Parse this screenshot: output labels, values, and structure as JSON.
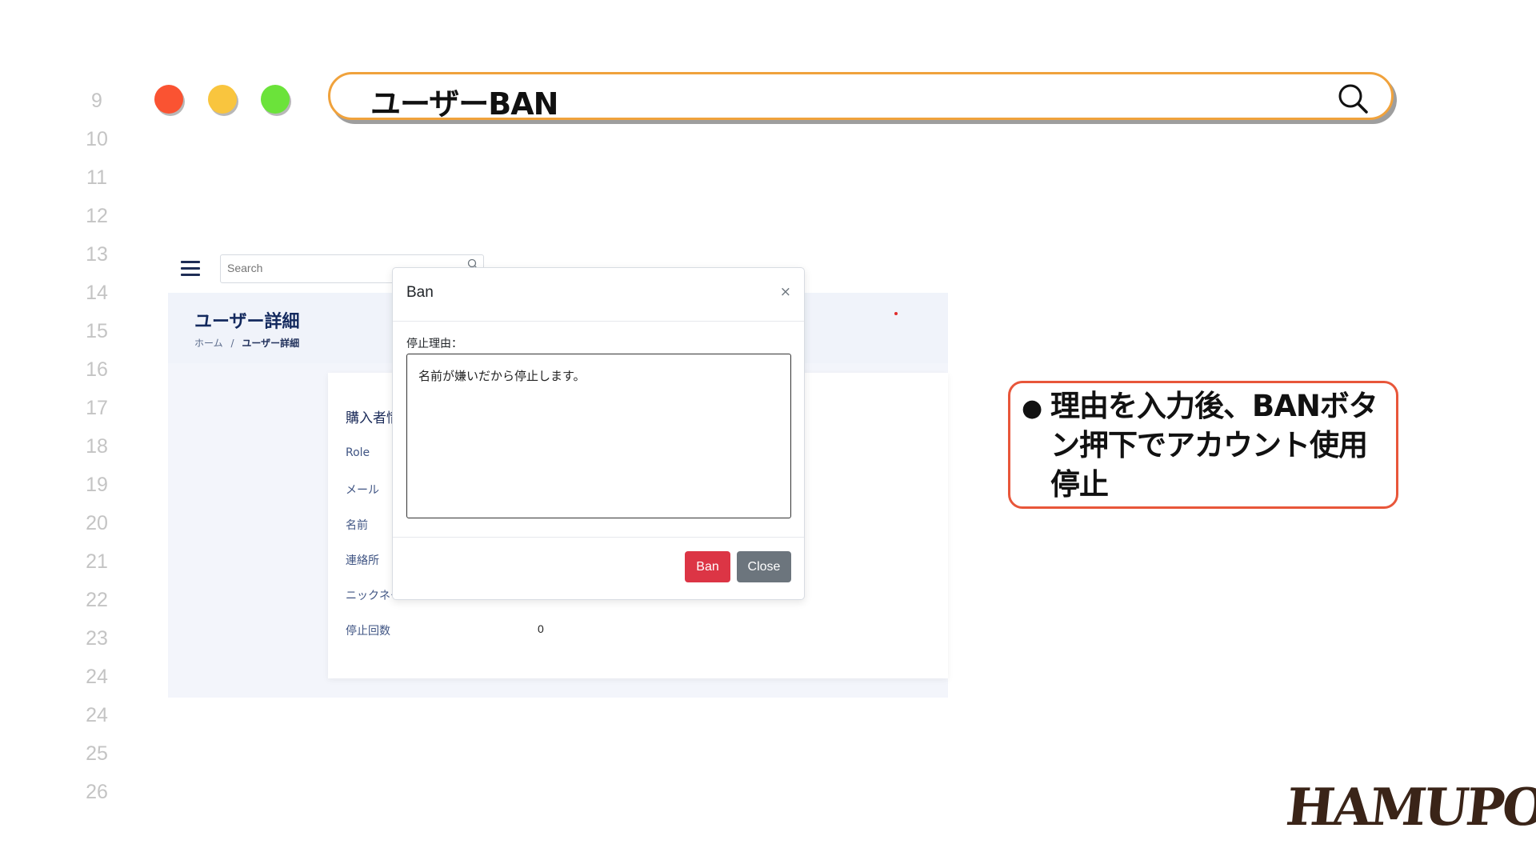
{
  "line_numbers": [
    "9",
    "10",
    "11",
    "12",
    "13",
    "14",
    "15",
    "16",
    "17",
    "18",
    "19",
    "20",
    "21",
    "22",
    "23",
    "24",
    "24",
    "25",
    "26"
  ],
  "titlebar": {
    "title": "ユーザーBAN",
    "search_icon": "search-icon"
  },
  "app": {
    "search_placeholder": "Search",
    "page_title": "ユーザー詳細",
    "breadcrumb": {
      "home": "ホーム",
      "separator": "/",
      "current": "ユーザー詳細"
    },
    "card_title": "購入者情報",
    "fields": [
      {
        "label": "Role",
        "value": ""
      },
      {
        "label": "メール",
        "value": ""
      },
      {
        "label": "名前",
        "value": ""
      },
      {
        "label": "連絡所",
        "value": ""
      },
      {
        "label": "ニックネーム",
        "value": ""
      },
      {
        "label": "停止回数",
        "value": "0"
      }
    ]
  },
  "modal": {
    "title": "Ban",
    "close_symbol": "×",
    "reason_label": "停止理由：",
    "reason_value": "名前が嫌いだから停止します。",
    "ban_button": "Ban",
    "close_button": "Close"
  },
  "note": {
    "bullet": "●",
    "text": "理由を入力後、BANボタン押下でアカウント使用停止"
  },
  "logo": "HAMUPOCHI",
  "colors": {
    "accent_orange": "#f0a23c",
    "note_border": "#e8563a",
    "ban_red": "#dc3545",
    "close_gray": "#6c757d",
    "dot_red": "#fa5332",
    "dot_yellow": "#f9c53e",
    "dot_green": "#6be33a"
  }
}
